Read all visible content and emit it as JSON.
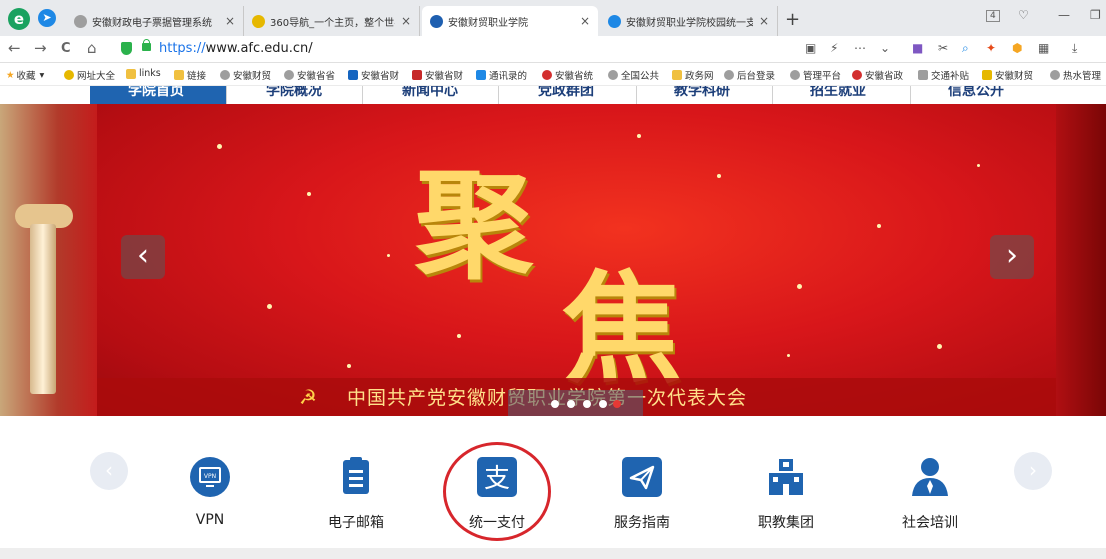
{
  "browser": {
    "tabs": [
      {
        "title": "安徽财政电子票据管理系统",
        "active": false,
        "icon_color": "#9e9e9e"
      },
      {
        "title": "360导航_一个主页，整个世界",
        "active": false,
        "icon_color": "#e6b800"
      },
      {
        "title": "安徽财贸职业学院",
        "active": true,
        "icon_color": "#1e5fb0"
      },
      {
        "title": "安徽财贸职业学院校园统一支",
        "active": false,
        "icon_color": "#1e88e5"
      }
    ],
    "new_tab": "+",
    "window_badge": "4",
    "url_scheme": "https://",
    "url_rest": "www.afc.edu.cn/",
    "nav": {
      "back": "←",
      "forward": "→",
      "reload": "C",
      "home": "⌂"
    },
    "bookmarks": [
      {
        "label": "收藏",
        "color": "#f5a623"
      },
      {
        "label": "网址大全",
        "color": "#e6b800"
      },
      {
        "label": "links",
        "color": "#f0c040"
      },
      {
        "label": "链接",
        "color": "#f0c040"
      },
      {
        "label": "安徽财贸",
        "color": "#9e9e9e"
      },
      {
        "label": "安徽省省",
        "color": "#9e9e9e"
      },
      {
        "label": "安徽省财",
        "color": "#1565c0"
      },
      {
        "label": "安徽省财",
        "color": "#c62828"
      },
      {
        "label": "通讯录的",
        "color": "#1e88e5"
      },
      {
        "label": "安徽省统",
        "color": "#d32f2f"
      },
      {
        "label": "全国公共",
        "color": "#9e9e9e"
      },
      {
        "label": "政务网",
        "color": "#f0c040"
      },
      {
        "label": "后台登录",
        "color": "#9e9e9e"
      },
      {
        "label": "管理平台",
        "color": "#9e9e9e"
      },
      {
        "label": "安徽省政",
        "color": "#d32f2f"
      },
      {
        "label": "交通补贴",
        "color": "#9e9e9e"
      },
      {
        "label": "安徽财贸",
        "color": "#e6b800"
      },
      {
        "label": "热水管理",
        "color": "#9e9e9e"
      }
    ]
  },
  "site_nav": [
    "学院首页",
    "学院概况",
    "新闻中心",
    "党政群团",
    "教学科研",
    "招生就业",
    "信息公开"
  ],
  "banner": {
    "big_text_1": "聚",
    "big_text_2": "焦",
    "caption": "中国共产党安徽财贸职业学院第一次代表大会",
    "prev": "‹",
    "next": "›",
    "slide_count": 5,
    "active_slide": 4
  },
  "services": [
    {
      "label": "VPN",
      "icon": "vpn-icon"
    },
    {
      "label": "电子邮箱",
      "icon": "mail-clipboard-icon"
    },
    {
      "label": "统一支付",
      "icon": "alipay-icon"
    },
    {
      "label": "服务指南",
      "icon": "paper-plane-icon"
    },
    {
      "label": "职教集团",
      "icon": "building-icon"
    },
    {
      "label": "社会培训",
      "icon": "person-icon"
    }
  ],
  "colors": {
    "accent_blue": "#1f64b0",
    "red_mark": "#d7262c"
  }
}
